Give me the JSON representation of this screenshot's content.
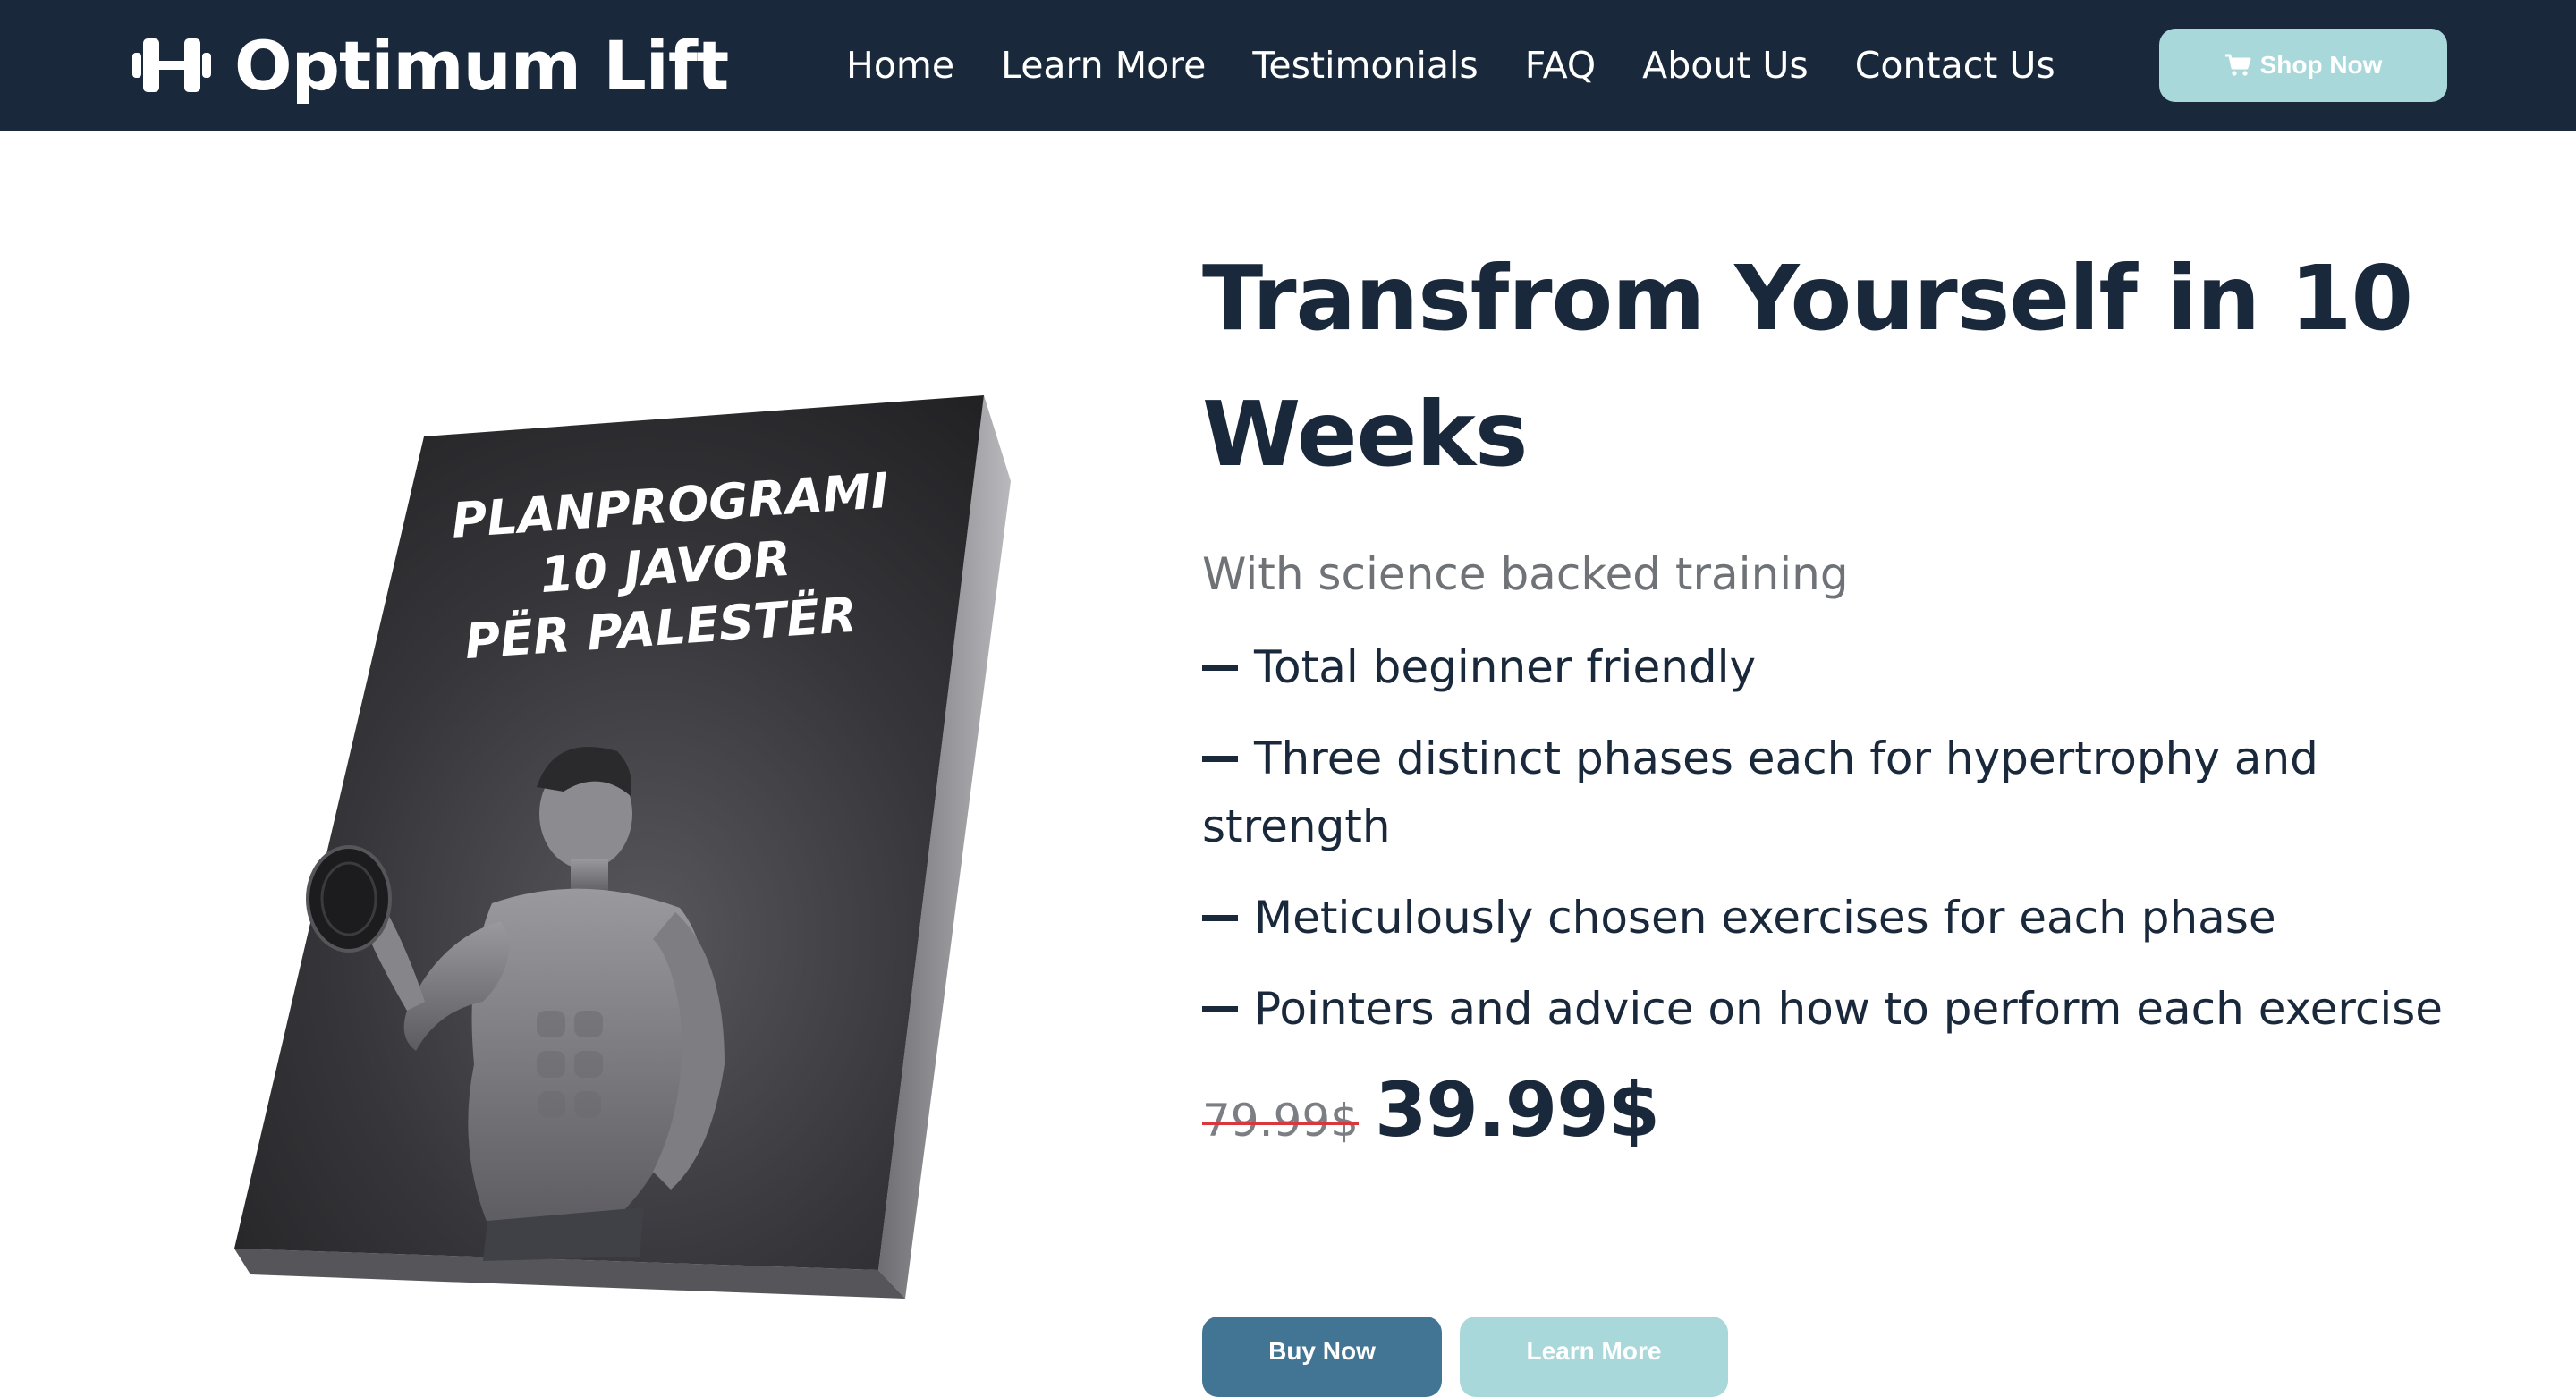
{
  "nav": {
    "brand_name": "Optimum Lift",
    "brand_icon": "dumbbell-icon",
    "links": [
      "Home",
      "Learn More",
      "Testimonials",
      "FAQ",
      "About Us",
      "Contact Us"
    ],
    "shop_label": "Shop Now",
    "shop_icon": "cart-icon"
  },
  "book": {
    "title_lines": [
      "PLANPROGRAMI",
      "10 JAVOR",
      "PËR PALESTËR"
    ]
  },
  "hero": {
    "title": "Transfrom Yourself in 10 Weeks",
    "subtitle": "With science backed training",
    "features": [
      "Total beginner friendly",
      "Three distinct phases each for hypertrophy and strength",
      "Meticulously chosen exercises for each phase",
      "Pointers and advice on how to perform each exercise"
    ],
    "old_price": "79.99$",
    "new_price": "39.99$",
    "buy_label": "Buy Now",
    "learn_label": "Learn More"
  },
  "colors": {
    "navbar": "#19283a",
    "accent_teal": "#a8d8da",
    "buy_blue": "#427593",
    "strike_red": "#d9363e"
  }
}
